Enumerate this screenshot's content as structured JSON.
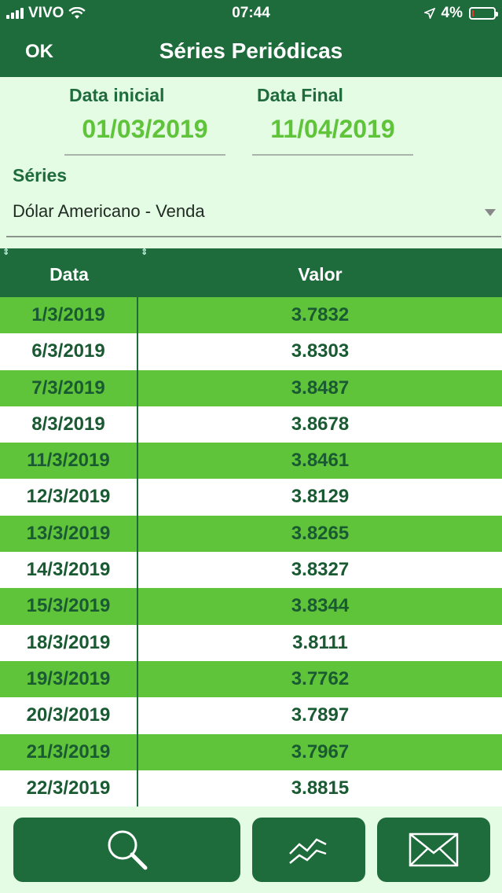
{
  "status_bar": {
    "carrier": "VIVO",
    "time": "07:44",
    "battery": "4%"
  },
  "nav": {
    "ok_label": "OK",
    "title": "Séries Periódicas"
  },
  "form": {
    "start_date_label": "Data inicial",
    "start_date_value": "01/03/2019",
    "end_date_label": "Data Final",
    "end_date_value": "11/04/2019",
    "series_label": "Séries",
    "series_value": "Dólar Americano - Venda"
  },
  "table": {
    "headers": [
      "Data",
      "Valor"
    ],
    "rows": [
      [
        "1/3/2019",
        "3.7832"
      ],
      [
        "6/3/2019",
        "3.8303"
      ],
      [
        "7/3/2019",
        "3.8487"
      ],
      [
        "8/3/2019",
        "3.8678"
      ],
      [
        "11/3/2019",
        "3.8461"
      ],
      [
        "12/3/2019",
        "3.8129"
      ],
      [
        "13/3/2019",
        "3.8265"
      ],
      [
        "14/3/2019",
        "3.8327"
      ],
      [
        "15/3/2019",
        "3.8344"
      ],
      [
        "18/3/2019",
        "3.8111"
      ],
      [
        "19/3/2019",
        "3.7762"
      ],
      [
        "20/3/2019",
        "3.7897"
      ],
      [
        "21/3/2019",
        "3.7967"
      ],
      [
        "22/3/2019",
        "3.8815"
      ]
    ]
  },
  "toolbar": {
    "icons": [
      "search-icon",
      "chart-icon",
      "mail-icon"
    ]
  },
  "colors": {
    "primary": "#1e6b3b",
    "accent": "#5fc43a",
    "background": "#e4fbe4"
  }
}
